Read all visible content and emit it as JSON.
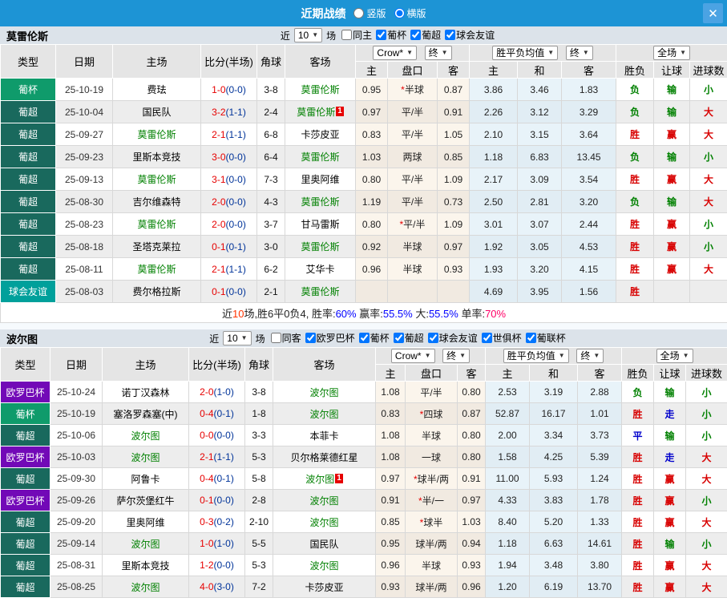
{
  "icons": {
    "close": "✕",
    "dropdown": "▼"
  },
  "titlebar": {
    "title": "近期战绩",
    "options": [
      {
        "label": "竖版",
        "checked": false
      },
      {
        "label": "横版",
        "checked": true
      }
    ]
  },
  "hdr": {
    "type": "类型",
    "date": "日期",
    "home": "主场",
    "score": "比分(半场)",
    "corner": "角球",
    "away": "客场",
    "sub": [
      "主",
      "盘口",
      "客",
      "主",
      "和",
      "客",
      "胜负",
      "让球",
      "进球数"
    ],
    "bookmaker": "Crow*",
    "final": "终",
    "avg": "胜平负均值",
    "scope": "全场"
  },
  "s1": {
    "team": "莫雷伦斯",
    "near": "近",
    "count": "10",
    "games": "场",
    "filters": [
      {
        "label": "同主",
        "checked": false
      },
      {
        "label": "葡杯",
        "checked": true
      },
      {
        "label": "葡超",
        "checked": true
      },
      {
        "label": "球会友谊",
        "checked": true
      }
    ],
    "rows": [
      {
        "type": "葡杯",
        "type_bg": "#0f9b6b",
        "date": "25-10-19",
        "home": "费珐",
        "home_c": "#000000",
        "home_b": "",
        "ft": "1-0",
        "ht": "(0-0)",
        "corner": "3-8",
        "away": "莫雷伦斯",
        "away_c": "#008000",
        "away_b": "",
        "o1": "0.95",
        "star": "*",
        "pk": "半球",
        "o2": "0.87",
        "m1": "3.86",
        "m2": "3.46",
        "m3": "1.83",
        "r1": "负",
        "r1c": "#008000",
        "r2": "输",
        "r2c": "#008000",
        "r3": "小",
        "r3c": "#008000"
      },
      {
        "type": "葡超",
        "type_bg": "#19695d",
        "date": "25-10-04",
        "home": "国民队",
        "home_c": "#000000",
        "home_b": "",
        "ft": "3-2",
        "ht": "(1-1)",
        "corner": "2-4",
        "away": "莫雷伦斯",
        "away_c": "#008000",
        "away_b": "1",
        "o1": "0.97",
        "star": "",
        "pk": "平/半",
        "o2": "0.91",
        "m1": "2.26",
        "m2": "3.12",
        "m3": "3.29",
        "r1": "负",
        "r1c": "#008000",
        "r2": "输",
        "r2c": "#008000",
        "r3": "大",
        "r3c": "#d80000"
      },
      {
        "type": "葡超",
        "type_bg": "#19695d",
        "date": "25-09-27",
        "home": "莫雷伦斯",
        "home_c": "#008000",
        "home_b": "",
        "ft": "2-1",
        "ht": "(1-1)",
        "corner": "6-8",
        "away": "卡莎皮亚",
        "away_c": "#000000",
        "away_b": "",
        "o1": "0.83",
        "star": "",
        "pk": "平/半",
        "o2": "1.05",
        "m1": "2.10",
        "m2": "3.15",
        "m3": "3.64",
        "r1": "胜",
        "r1c": "#d80000",
        "r2": "赢",
        "r2c": "#d80000",
        "r3": "大",
        "r3c": "#d80000"
      },
      {
        "type": "葡超",
        "type_bg": "#19695d",
        "date": "25-09-23",
        "home": "里斯本竞技",
        "home_c": "#000000",
        "home_b": "",
        "ft": "3-0",
        "ht": "(0-0)",
        "corner": "6-4",
        "away": "莫雷伦斯",
        "away_c": "#008000",
        "away_b": "",
        "o1": "1.03",
        "star": "",
        "pk": "两球",
        "o2": "0.85",
        "m1": "1.18",
        "m2": "6.83",
        "m3": "13.45",
        "r1": "负",
        "r1c": "#008000",
        "r2": "输",
        "r2c": "#008000",
        "r3": "小",
        "r3c": "#008000"
      },
      {
        "type": "葡超",
        "type_bg": "#19695d",
        "date": "25-09-13",
        "home": "莫雷伦斯",
        "home_c": "#008000",
        "home_b": "",
        "ft": "3-1",
        "ht": "(0-0)",
        "corner": "7-3",
        "away": "里奥阿维",
        "away_c": "#000000",
        "away_b": "",
        "o1": "0.80",
        "star": "",
        "pk": "平/半",
        "o2": "1.09",
        "m1": "2.17",
        "m2": "3.09",
        "m3": "3.54",
        "r1": "胜",
        "r1c": "#d80000",
        "r2": "赢",
        "r2c": "#d80000",
        "r3": "大",
        "r3c": "#d80000"
      },
      {
        "type": "葡超",
        "type_bg": "#19695d",
        "date": "25-08-30",
        "home": "吉尔维森特",
        "home_c": "#000000",
        "home_b": "",
        "ft": "2-0",
        "ht": "(0-0)",
        "corner": "4-3",
        "away": "莫雷伦斯",
        "away_c": "#008000",
        "away_b": "",
        "o1": "1.19",
        "star": "",
        "pk": "平/半",
        "o2": "0.73",
        "m1": "2.50",
        "m2": "2.81",
        "m3": "3.20",
        "r1": "负",
        "r1c": "#008000",
        "r2": "输",
        "r2c": "#008000",
        "r3": "大",
        "r3c": "#d80000"
      },
      {
        "type": "葡超",
        "type_bg": "#19695d",
        "date": "25-08-23",
        "home": "莫雷伦斯",
        "home_c": "#008000",
        "home_b": "",
        "ft": "2-0",
        "ht": "(0-0)",
        "corner": "3-7",
        "away": "甘马雷斯",
        "away_c": "#000000",
        "away_b": "",
        "o1": "0.80",
        "star": "*",
        "pk": "平/半",
        "o2": "1.09",
        "m1": "3.01",
        "m2": "3.07",
        "m3": "2.44",
        "r1": "胜",
        "r1c": "#d80000",
        "r2": "赢",
        "r2c": "#d80000",
        "r3": "小",
        "r3c": "#008000"
      },
      {
        "type": "葡超",
        "type_bg": "#19695d",
        "date": "25-08-18",
        "home": "圣塔克莱拉",
        "home_c": "#000000",
        "home_b": "",
        "ft": "0-1",
        "ht": "(0-1)",
        "corner": "3-0",
        "away": "莫雷伦斯",
        "away_c": "#008000",
        "away_b": "",
        "o1": "0.92",
        "star": "",
        "pk": "半球",
        "o2": "0.97",
        "m1": "1.92",
        "m2": "3.05",
        "m3": "4.53",
        "r1": "胜",
        "r1c": "#d80000",
        "r2": "赢",
        "r2c": "#d80000",
        "r3": "小",
        "r3c": "#008000"
      },
      {
        "type": "葡超",
        "type_bg": "#19695d",
        "date": "25-08-11",
        "home": "莫雷伦斯",
        "home_c": "#008000",
        "home_b": "",
        "ft": "2-1",
        "ht": "(1-1)",
        "corner": "6-2",
        "away": "艾华卡",
        "away_c": "#000000",
        "away_b": "",
        "o1": "0.96",
        "star": "",
        "pk": "半球",
        "o2": "0.93",
        "m1": "1.93",
        "m2": "3.20",
        "m3": "4.15",
        "r1": "胜",
        "r1c": "#d80000",
        "r2": "赢",
        "r2c": "#d80000",
        "r3": "大",
        "r3c": "#d80000"
      },
      {
        "type": "球会友谊",
        "type_bg": "#00a09b",
        "date": "25-08-03",
        "home": "费尔格拉斯",
        "home_c": "#000000",
        "home_b": "",
        "ft": "0-1",
        "ht": "(0-0)",
        "corner": "2-1",
        "away": "莫雷伦斯",
        "away_c": "#008000",
        "away_b": "",
        "o1": "",
        "star": "",
        "pk": "",
        "o2": "",
        "m1": "4.69",
        "m2": "3.95",
        "m3": "1.56",
        "r1": "胜",
        "r1c": "#d80000",
        "r2": "",
        "r2c": "#222222",
        "r3": "",
        "r3c": "#222222"
      }
    ],
    "summary": [
      {
        "t": "近",
        "c": "#222222"
      },
      {
        "t": "10",
        "c": "#ff3300"
      },
      {
        "t": "场,胜6平0负4, 胜率:",
        "c": "#222222"
      },
      {
        "t": "60%",
        "c": "#0000ff"
      },
      {
        "t": " 赢率:",
        "c": "#222222"
      },
      {
        "t": "55.5%",
        "c": "#0000ff"
      },
      {
        "t": " 大:",
        "c": "#222222"
      },
      {
        "t": "55.5%",
        "c": "#0000ff"
      },
      {
        "t": " 单率:",
        "c": "#222222"
      },
      {
        "t": "70%",
        "c": "#ff0066"
      }
    ]
  },
  "s2": {
    "team": "波尔图",
    "near": "近",
    "count": "10",
    "games": "场",
    "filters": [
      {
        "label": "同客",
        "checked": false
      },
      {
        "label": "欧罗巴杯",
        "checked": true
      },
      {
        "label": "葡杯",
        "checked": true
      },
      {
        "label": "葡超",
        "checked": true
      },
      {
        "label": "球会友谊",
        "checked": true
      },
      {
        "label": "世俱杯",
        "checked": true
      },
      {
        "label": "葡联杯",
        "checked": true
      }
    ],
    "rows": [
      {
        "type": "欧罗巴杯",
        "type_bg": "#7209b7",
        "date": "25-10-24",
        "home": "诺丁汉森林",
        "home_c": "#000000",
        "home_b": "",
        "ft": "2-0",
        "ht": "(1-0)",
        "corner": "3-8",
        "away": "波尔图",
        "away_c": "#008000",
        "away_b": "",
        "o1": "1.08",
        "star": "",
        "pk": "平/半",
        "o2": "0.80",
        "m1": "2.53",
        "m2": "3.19",
        "m3": "2.88",
        "r1": "负",
        "r1c": "#008000",
        "r2": "输",
        "r2c": "#008000",
        "r3": "小",
        "r3c": "#008000"
      },
      {
        "type": "葡杯",
        "type_bg": "#0f9b6b",
        "date": "25-10-19",
        "home": "塞洛罗森塞(中)",
        "home_c": "#000000",
        "home_b": "",
        "ft": "0-4",
        "ht": "(0-1)",
        "corner": "1-8",
        "away": "波尔图",
        "away_c": "#008000",
        "away_b": "",
        "o1": "0.83",
        "star": "*",
        "pk": "四球",
        "o2": "0.87",
        "m1": "52.87",
        "m2": "16.17",
        "m3": "1.01",
        "r1": "胜",
        "r1c": "#d80000",
        "r2": "走",
        "r2c": "#0000cc",
        "r3": "小",
        "r3c": "#008000"
      },
      {
        "type": "葡超",
        "type_bg": "#19695d",
        "date": "25-10-06",
        "home": "波尔图",
        "home_c": "#008000",
        "home_b": "",
        "ft": "0-0",
        "ht": "(0-0)",
        "corner": "3-3",
        "away": "本菲卡",
        "away_c": "#000000",
        "away_b": "",
        "o1": "1.08",
        "star": "",
        "pk": "半球",
        "o2": "0.80",
        "m1": "2.00",
        "m2": "3.34",
        "m3": "3.73",
        "r1": "平",
        "r1c": "#0000cc",
        "r2": "输",
        "r2c": "#008000",
        "r3": "小",
        "r3c": "#008000"
      },
      {
        "type": "欧罗巴杯",
        "type_bg": "#7209b7",
        "date": "25-10-03",
        "home": "波尔图",
        "home_c": "#008000",
        "home_b": "",
        "ft": "2-1",
        "ht": "(1-1)",
        "corner": "5-3",
        "away": "贝尔格莱德红星",
        "away_c": "#000000",
        "away_b": "",
        "o1": "1.08",
        "star": "",
        "pk": "一球",
        "o2": "0.80",
        "m1": "1.58",
        "m2": "4.25",
        "m3": "5.39",
        "r1": "胜",
        "r1c": "#d80000",
        "r2": "走",
        "r2c": "#0000cc",
        "r3": "大",
        "r3c": "#d80000"
      },
      {
        "type": "葡超",
        "type_bg": "#19695d",
        "date": "25-09-30",
        "home": "阿鲁卡",
        "home_c": "#000000",
        "home_b": "",
        "ft": "0-4",
        "ht": "(0-1)",
        "corner": "5-8",
        "away": "波尔图",
        "away_c": "#008000",
        "away_b": "1",
        "o1": "0.97",
        "star": "*",
        "pk": "球半/两",
        "o2": "0.91",
        "m1": "11.00",
        "m2": "5.93",
        "m3": "1.24",
        "r1": "胜",
        "r1c": "#d80000",
        "r2": "赢",
        "r2c": "#d80000",
        "r3": "大",
        "r3c": "#d80000"
      },
      {
        "type": "欧罗巴杯",
        "type_bg": "#7209b7",
        "date": "25-09-26",
        "home": "萨尔茨堡红牛",
        "home_c": "#000000",
        "home_b": "",
        "ft": "0-1",
        "ht": "(0-0)",
        "corner": "2-8",
        "away": "波尔图",
        "away_c": "#008000",
        "away_b": "",
        "o1": "0.91",
        "star": "*",
        "pk": "半/一",
        "o2": "0.97",
        "m1": "4.33",
        "m2": "3.83",
        "m3": "1.78",
        "r1": "胜",
        "r1c": "#d80000",
        "r2": "赢",
        "r2c": "#d80000",
        "r3": "小",
        "r3c": "#008000"
      },
      {
        "type": "葡超",
        "type_bg": "#19695d",
        "date": "25-09-20",
        "home": "里奥阿维",
        "home_c": "#000000",
        "home_b": "",
        "ft": "0-3",
        "ht": "(0-2)",
        "corner": "2-10",
        "away": "波尔图",
        "away_c": "#008000",
        "away_b": "",
        "o1": "0.85",
        "star": "*",
        "pk": "球半",
        "o2": "1.03",
        "m1": "8.40",
        "m2": "5.20",
        "m3": "1.33",
        "r1": "胜",
        "r1c": "#d80000",
        "r2": "赢",
        "r2c": "#d80000",
        "r3": "大",
        "r3c": "#d80000"
      },
      {
        "type": "葡超",
        "type_bg": "#19695d",
        "date": "25-09-14",
        "home": "波尔图",
        "home_c": "#008000",
        "home_b": "",
        "ft": "1-0",
        "ht": "(1-0)",
        "corner": "5-5",
        "away": "国民队",
        "away_c": "#000000",
        "away_b": "",
        "o1": "0.95",
        "star": "",
        "pk": "球半/两",
        "o2": "0.94",
        "m1": "1.18",
        "m2": "6.63",
        "m3": "14.61",
        "r1": "胜",
        "r1c": "#d80000",
        "r2": "输",
        "r2c": "#008000",
        "r3": "小",
        "r3c": "#008000"
      },
      {
        "type": "葡超",
        "type_bg": "#19695d",
        "date": "25-08-31",
        "home": "里斯本竞技",
        "home_c": "#000000",
        "home_b": "",
        "ft": "1-2",
        "ht": "(0-0)",
        "corner": "5-3",
        "away": "波尔图",
        "away_c": "#008000",
        "away_b": "",
        "o1": "0.96",
        "star": "",
        "pk": "半球",
        "o2": "0.93",
        "m1": "1.94",
        "m2": "3.48",
        "m3": "3.80",
        "r1": "胜",
        "r1c": "#d80000",
        "r2": "赢",
        "r2c": "#d80000",
        "r3": "大",
        "r3c": "#d80000"
      },
      {
        "type": "葡超",
        "type_bg": "#19695d",
        "date": "25-08-25",
        "home": "波尔图",
        "home_c": "#008000",
        "home_b": "",
        "ft": "4-0",
        "ht": "(3-0)",
        "corner": "7-2",
        "away": "卡莎皮亚",
        "away_c": "#000000",
        "away_b": "",
        "o1": "0.93",
        "star": "",
        "pk": "球半/两",
        "o2": "0.96",
        "m1": "1.20",
        "m2": "6.19",
        "m3": "13.70",
        "r1": "胜",
        "r1c": "#d80000",
        "r2": "赢",
        "r2c": "#d80000",
        "r3": "大",
        "r3c": "#d80000"
      }
    ]
  }
}
